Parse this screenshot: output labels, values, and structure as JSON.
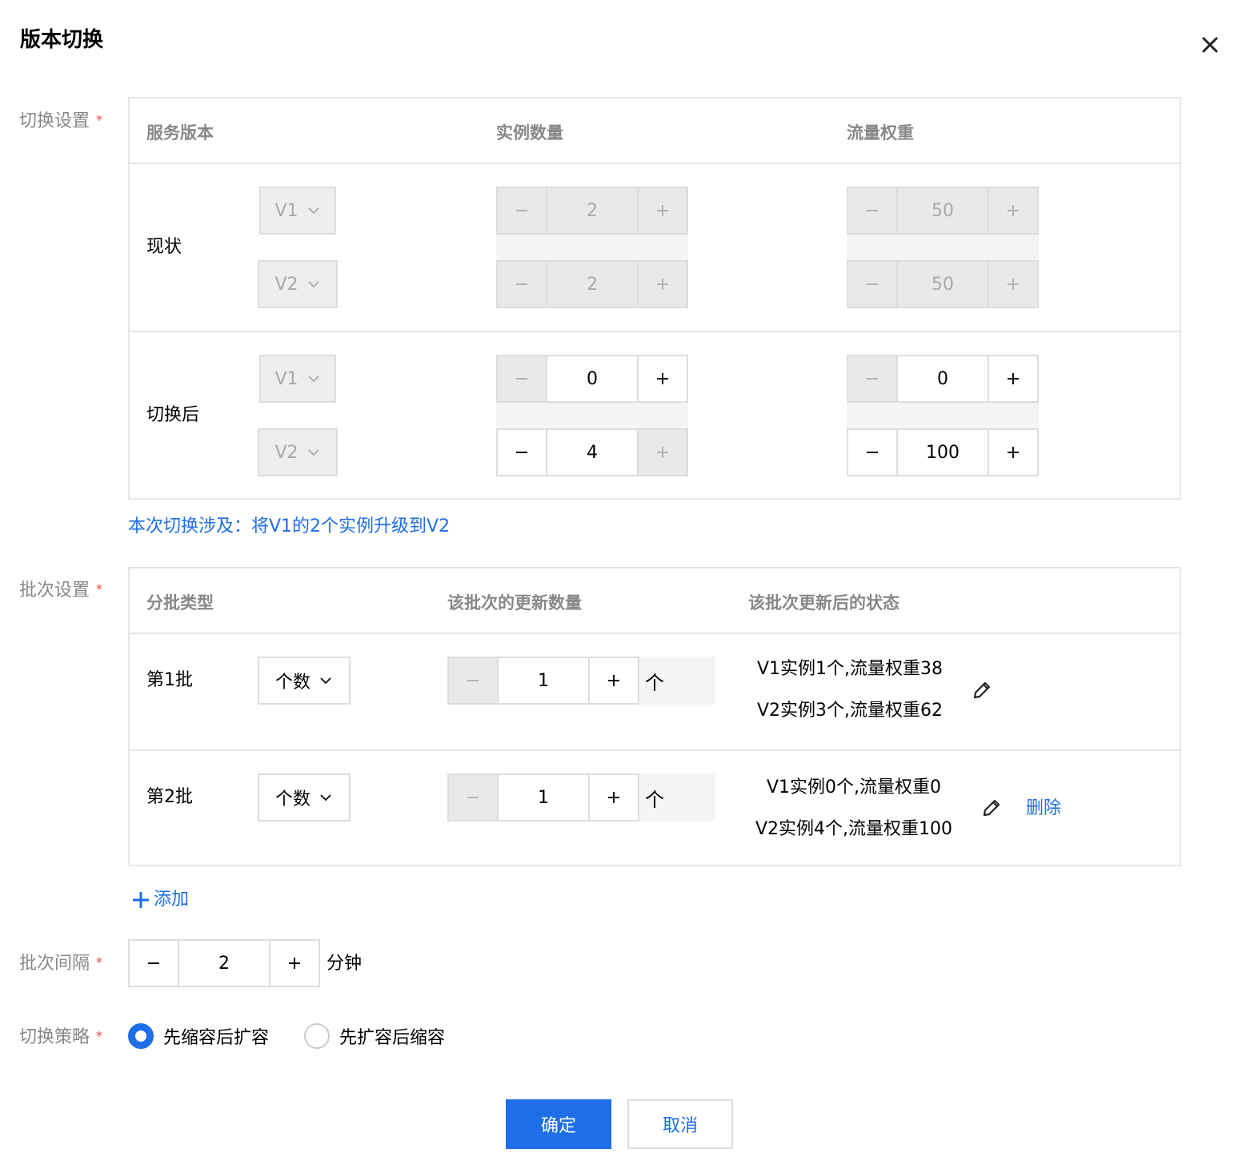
{
  "dialog": {
    "title": "版本切换"
  },
  "switch_settings": {
    "label": "切换设置",
    "columns": [
      "服务版本",
      "实例数量",
      "流量权重"
    ],
    "rows": [
      {
        "label": "现状",
        "items": [
          {
            "version": "V1",
            "instances": "2",
            "weight": "50"
          },
          {
            "version": "V2",
            "instances": "2",
            "weight": "50"
          }
        ]
      },
      {
        "label": "切换后",
        "items": [
          {
            "version": "V1",
            "instances": "0",
            "weight": "0"
          },
          {
            "version": "V2",
            "instances": "4",
            "weight": "100"
          }
        ]
      }
    ],
    "summary": "本次切换涉及：将V1的2个实例升级到V2"
  },
  "batch_settings": {
    "label": "批次设置",
    "columns": [
      "分批类型",
      "该批次的更新数量",
      "该批次更新后的状态"
    ],
    "rows": [
      {
        "label": "第1批",
        "type": "个数",
        "count": "1",
        "unit": "个",
        "status_v1": "V1实例1个,流量权重38",
        "status_v2": "V2实例3个,流量权重62"
      },
      {
        "label": "第2批",
        "type": "个数",
        "count": "1",
        "unit": "个",
        "status_v1": "V1实例0个,流量权重0",
        "status_v2": "V2实例4个,流量权重100",
        "delete_label": "删除"
      }
    ],
    "add_label": "添加"
  },
  "batch_interval": {
    "label": "批次间隔",
    "value": "2",
    "unit": "分钟"
  },
  "switch_strategy": {
    "label": "切换策略",
    "options": [
      "先缩容后扩容",
      "先扩容后缩容"
    ],
    "selected": "先缩容后扩容"
  },
  "footer": {
    "confirm_label": "确定",
    "cancel_label": "取消"
  },
  "colors": {
    "accent": "#1e6ee8",
    "required": "#e54545",
    "border": "#e6e6e6",
    "disabled_bg": "#e9e9e9"
  },
  "icons": [
    "close-icon",
    "chevron-down-icon",
    "minus-icon",
    "plus-icon",
    "pencil-icon"
  ]
}
